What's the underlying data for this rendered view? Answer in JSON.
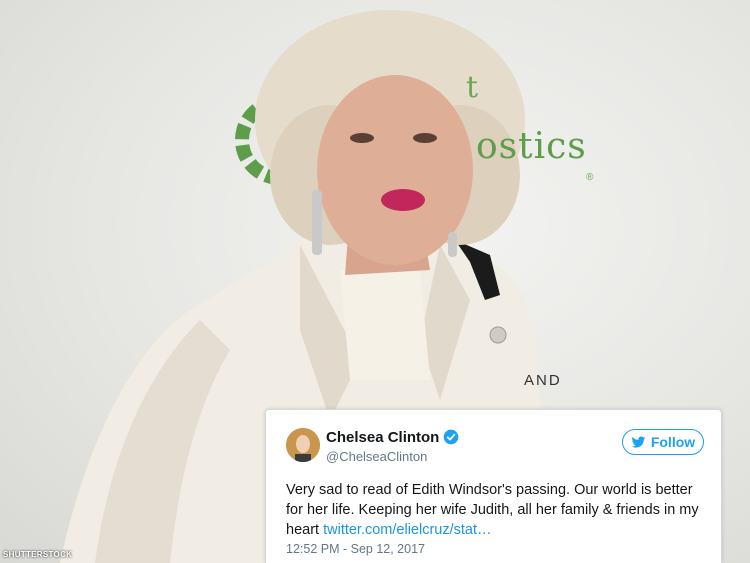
{
  "photo": {
    "sponsor_text_top": "t",
    "sponsor_text": "ostics",
    "sponsor_mark": "®",
    "sponsor_and": "AND",
    "credit": "SHUTTERSTOCK"
  },
  "tweet": {
    "author_name": "Chelsea Clinton",
    "author_handle": "@ChelseaClinton",
    "follow_label": "Follow",
    "text": "Very sad to read of Edith Windsor's passing. Our world is better for her life. Keeping her wife Judith, all her family & friends in my heart ",
    "link_text": "twitter.com/elielcruz/stat…",
    "timestamp": "12:52 PM - Sep 12, 2017"
  },
  "colors": {
    "twitter_blue": "#1da1f2",
    "link_blue": "#1b95e0",
    "verified_blue": "#1da1f2",
    "sponsor_green": "#5e9d4a"
  },
  "icons": {
    "verified": "verified-badge-icon",
    "follow": "twitter-bird-icon"
  }
}
